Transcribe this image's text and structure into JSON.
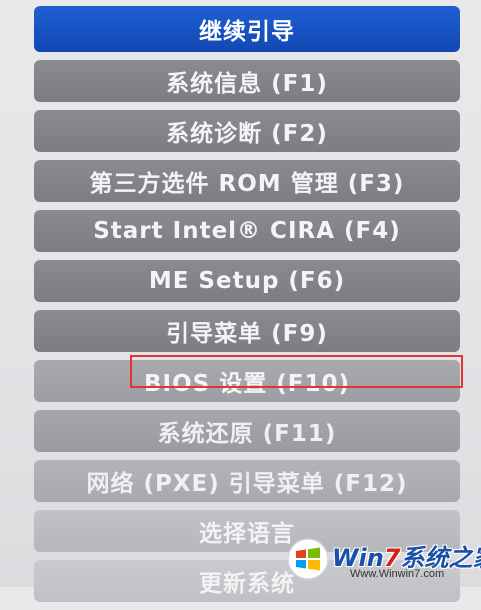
{
  "menu": {
    "items": [
      {
        "label": "继续引导"
      },
      {
        "label": "系统信息 (F1)"
      },
      {
        "label": "系统诊断 (F2)"
      },
      {
        "label": "第三方选件 ROM 管理 (F3)"
      },
      {
        "label": "Start Intel® CIRA (F4)"
      },
      {
        "label": "ME Setup (F6)"
      },
      {
        "label": "引导菜单 (F9)"
      },
      {
        "label": "BIOS 设置 (F10)"
      },
      {
        "label": "系统还原 (F11)"
      },
      {
        "label": "网络 (PXE) 引导菜单 (F12)"
      },
      {
        "label": "选择语言"
      },
      {
        "label": "更新系统"
      }
    ],
    "selected_index": 0,
    "highlighted_index": 7
  },
  "colors": {
    "selected": "#1a55c6",
    "item": "#82838a",
    "annotation": "#e53238",
    "background": "#e6e6e9"
  },
  "watermark": {
    "title_prefix": "Win",
    "title_seven": "7",
    "title_suffix": "系统之家",
    "url": "Www.Winwin7.com",
    "icon": "windows-logo-icon"
  }
}
